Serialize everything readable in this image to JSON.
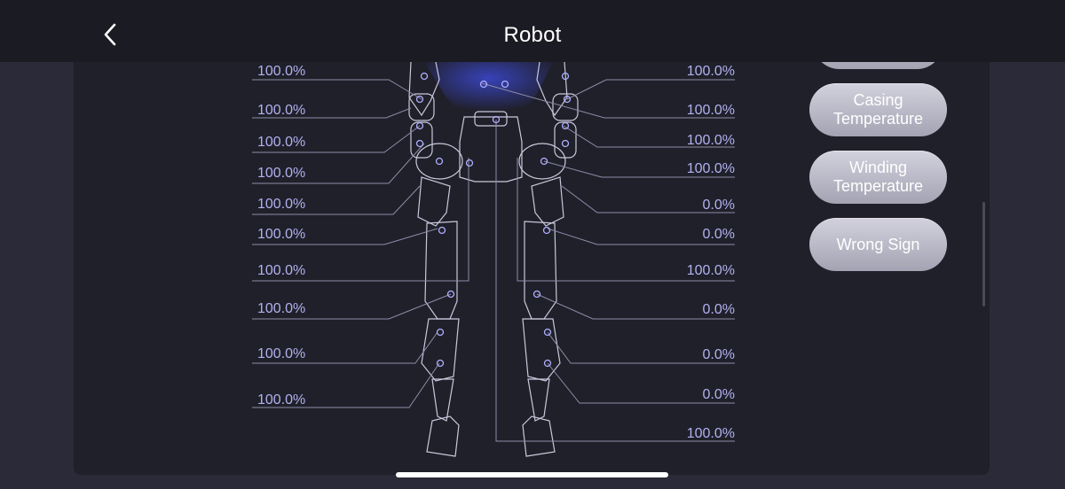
{
  "header": {
    "title": "Robot",
    "back_icon": "chevron-left-icon"
  },
  "left_values": [
    "100.0%",
    "100.0%",
    "100.0%",
    "100.0%",
    "100.0%",
    "100.0%",
    "100.0%",
    "100.0%",
    "100.0%",
    "100.0%"
  ],
  "right_values": [
    "100.0%",
    "100.0%",
    "100.0%",
    "100.0%",
    "0.0%",
    "0.0%",
    "100.0%",
    "0.0%",
    "0.0%",
    "0.0%",
    "100.0%"
  ],
  "filters": {
    "items": [
      {
        "label": "Casing Temperature"
      },
      {
        "label": "Winding Temperature"
      },
      {
        "label": "Wrong Sign"
      }
    ]
  },
  "colors": {
    "accent_text": "#b3b1f0",
    "button_bg": "#bdbccb",
    "glow": "#3a46c8"
  }
}
